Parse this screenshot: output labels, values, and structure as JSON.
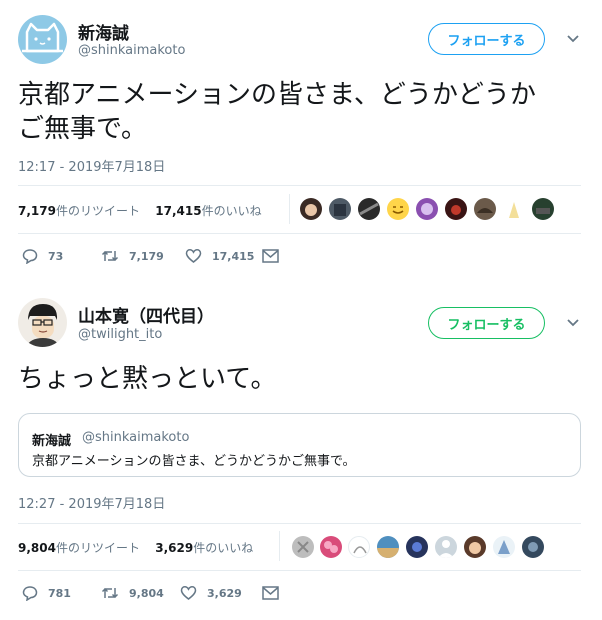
{
  "tweets": [
    {
      "author_name": "新海誠",
      "author_handle": "@shinkaimakoto",
      "follow_label": "フォローする",
      "text_lines": [
        "京都アニメーションの皆さま、どうかどうか",
        "ご無事で。"
      ],
      "timestamp": "12:17 - 2019年7月18日",
      "retweets_count": "7,179",
      "retweets_label": "件のリツイート",
      "likes_count": "17,415",
      "likes_label": "件のいいね",
      "actions": {
        "reply": "73",
        "retweet": "7,179",
        "like": "17,415"
      }
    },
    {
      "author_name": "山本寛（四代目）",
      "author_handle": "@twilight_ito",
      "follow_label": "フォローする",
      "text_lines": [
        "ちょっと黙っといて。"
      ],
      "quoted": {
        "author_name": "新海誠",
        "author_handle": "@shinkaimakoto",
        "text": "京都アニメーションの皆さま、どうかどうかご無事で。"
      },
      "timestamp": "12:27 - 2019年7月18日",
      "retweets_count": "9,804",
      "retweets_label": "件のリツイート",
      "likes_count": "3,629",
      "likes_label": "件のいいね",
      "actions": {
        "reply": "781",
        "retweet": "9,804",
        "like": "3,629"
      }
    }
  ],
  "colors": {
    "twitter_blue": "#1da1f2",
    "follow_green": "#17bf63",
    "text_primary": "#14171a",
    "text_secondary": "#657786",
    "divider": "#e6ecf0",
    "avatar_bg": "#8ec9e6"
  },
  "icons": [
    "cat-avatar",
    "person-avatar",
    "reply-icon",
    "retweet-icon",
    "like-icon",
    "dm-icon",
    "chevron-down-icon"
  ]
}
